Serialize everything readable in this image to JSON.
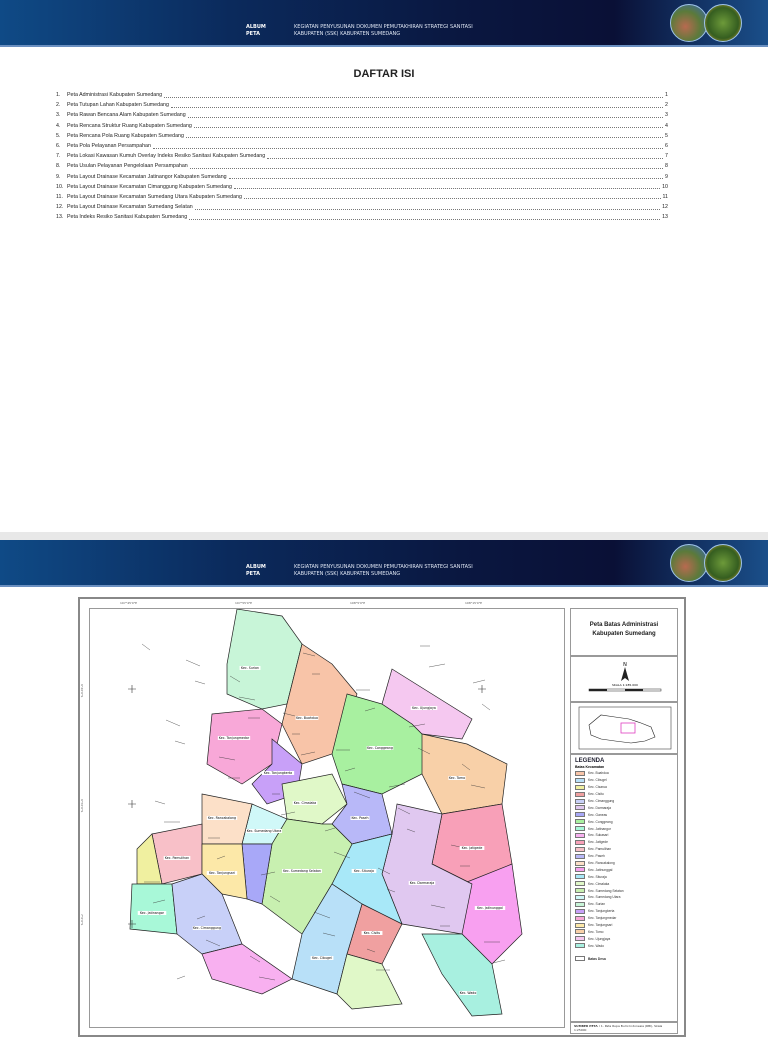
{
  "header": {
    "album_line1": "ALBUM",
    "album_line2": "PETA",
    "title_line1": "KEGIATAN PENYUSUNAN DOKUMEN PEMUTAKHIRAN STRATEGI SANITASI",
    "title_line2": "KABUPATEN (SSK) KABUPATEN SUMEDANG"
  },
  "toc": {
    "title": "DAFTAR ISI",
    "items": [
      {
        "num": "1.",
        "label": "Peta Administrasi Kabupaten Sumedang",
        "page": "1"
      },
      {
        "num": "2.",
        "label": "Peta Tutupan Lahan Kabupaten Sumedang",
        "page": "2"
      },
      {
        "num": "3.",
        "label": "Peta Rawan Bencana Alam Kabupaten Sumedang",
        "page": "3"
      },
      {
        "num": "4.",
        "label": "Peta Rencana Struktur Ruang Kabupaten Sumedang",
        "page": "4"
      },
      {
        "num": "5.",
        "label": "Peta Rencana Pola Ruang Kabupaten Sumedang",
        "page": "5"
      },
      {
        "num": "6.",
        "label": "Peta Pola Pelayanan Persampahan",
        "page": "6"
      },
      {
        "num": "7.",
        "label": "Peta Lokasi Kawasan Kumuh Overlay Indeks Resiko Sanitasi Kabupaten Sumedang",
        "page": "7"
      },
      {
        "num": "8.",
        "label": "Peta Usulan Pelayanan Pengelolaan Persampahan",
        "page": "8"
      },
      {
        "num": "9.",
        "label": "Peta Layout Drainase Kecamatan Jatinangor Kabupaten Sumedang",
        "page": "9"
      },
      {
        "num": "10.",
        "label": "Peta Layout Drainase Kecamatan Cimanggung Kabupaten Sumedang",
        "page": "10"
      },
      {
        "num": "11.",
        "label": "Peta Layout Drainase Kecamatan Sumedang Utara Kabupaten Sumedang",
        "page": "11"
      },
      {
        "num": "12.",
        "label": "Peta Layout Drainase Kecamatan Sumedang Selatan",
        "page": "12"
      },
      {
        "num": "13.",
        "label": "Peta Indeks Resiko Sanitasi Kabupaten Sumedang",
        "page": "13"
      }
    ]
  },
  "map": {
    "title_line1": "Peta Batas Administrasi",
    "title_line2": "Kabupaten Sumedang",
    "north": "N",
    "scale": "SKALA 1:185.000",
    "legend_title": "LEGENDA",
    "legend_sub": "Batas Kecamatan",
    "legend": [
      {
        "label": "Kec. Buahdua",
        "color": "#f8c4a8"
      },
      {
        "label": "Kec. Cibugel",
        "color": "#b8e0f8"
      },
      {
        "label": "Kec. Cisarua",
        "color": "#f0f0a0"
      },
      {
        "label": "Kec. Cisitu",
        "color": "#f0a0a0"
      },
      {
        "label": "Kec. Cimanggung",
        "color": "#c8d0f8"
      },
      {
        "label": "Kec. Darmaraja",
        "color": "#e0c8f0"
      },
      {
        "label": "Kec. Ganeas",
        "color": "#a8a8f8"
      },
      {
        "label": "Kec. Conggeang",
        "color": "#a8f0a0"
      },
      {
        "label": "Kec. Jatinangor",
        "color": "#a8f8d8"
      },
      {
        "label": "Kec. Sukasari",
        "color": "#f8b0f0"
      },
      {
        "label": "Kec. Jatigede",
        "color": "#f8a0b8"
      },
      {
        "label": "Kec. Pamulihan",
        "color": "#f8c0c8"
      },
      {
        "label": "Kec. Paseh",
        "color": "#b8b8f8"
      },
      {
        "label": "Kec. Rancakalong",
        "color": "#fce0c8"
      },
      {
        "label": "Kec. Jatinunggal",
        "color": "#f8a0f0"
      },
      {
        "label": "Kec. Situraja",
        "color": "#a8e8f8"
      },
      {
        "label": "Kec. Cimalaka",
        "color": "#e0f8c8"
      },
      {
        "label": "Kec. Sumedang Selatan",
        "color": "#c8f0b0"
      },
      {
        "label": "Kec. Sumedang Utara",
        "color": "#d0f8f8"
      },
      {
        "label": "Kec. Surian",
        "color": "#c8f5d8"
      },
      {
        "label": "Kec. Tanjungkerta",
        "color": "#c8a0f8"
      },
      {
        "label": "Kec. Tanjungmedar",
        "color": "#f8a8d8"
      },
      {
        "label": "Kec. Tanjungsari",
        "color": "#fce8a8"
      },
      {
        "label": "Kec. Tomo",
        "color": "#f8d0a8"
      },
      {
        "label": "Kec. Ujungjaya",
        "color": "#f5c8f0"
      },
      {
        "label": "Kec. Wado",
        "color": "#a8f0e0"
      }
    ],
    "batas_desa": "Batas Desa",
    "source_title": "SUMBER PETA :",
    "source_text": "1. Peta Rupa Bumi Indonesia (RBI), Skala 1:25000",
    "grid_top": [
      "107°45'0\"E",
      "107°55'0\"E",
      "108°5'0\"E",
      "108°15'0\"E"
    ],
    "grid_left": [
      "6°40'0\"S",
      "6°50'0\"S",
      "7°0'0\"S"
    ],
    "district_labels": [
      "Kec. Surian",
      "Kec. Buahdua",
      "Kec. Conggeang",
      "Kec. Ujungjaya",
      "Kec. Tanjungmedar",
      "Kec. Tanjungkerta",
      "Kec. Tomo",
      "Kec. Cimalaka",
      "Kec. Paseh",
      "Kec. Jatigede",
      "Kec. Rancakalong",
      "Kec. Sumedang Utara",
      "Kec. Sumedang Selatan",
      "Kec. Situraja",
      "Kec. Darmaraja",
      "Kec. Jatinunggal",
      "Kec. Wado",
      "Kec. Pamulihan",
      "Kec. Tanjungsari",
      "Kec. Jatinangor",
      "Kec. Cimanggung",
      "Kec. Cisitu",
      "Kec. Cibugel"
    ]
  }
}
